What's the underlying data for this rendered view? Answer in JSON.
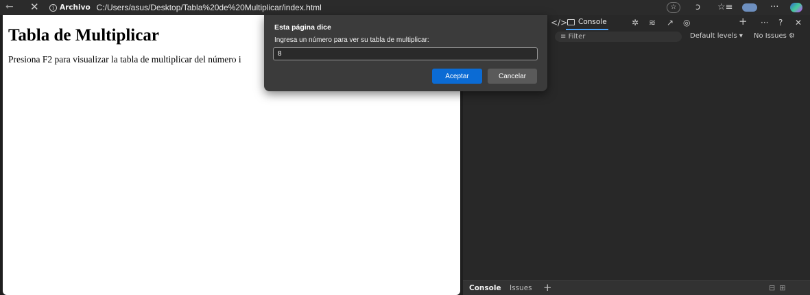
{
  "browser": {
    "address": {
      "chip_label": "Archivo",
      "url": "C:/Users/asus/Desktop/Tabla%20de%20Multiplicar/index.html"
    },
    "nav_icons": [
      "back-arrow-icon",
      "close-icon"
    ],
    "toolbar_icons": [
      "favorite-star-icon",
      "copilot-icon",
      "favorites-list-icon",
      "profile-avatar-icon",
      "more-options-icon",
      "edge-logo-icon"
    ]
  },
  "page": {
    "heading": "Tabla de Multiplicar",
    "text": "Presiona F2 para visualizar la tabla de multiplicar del número i"
  },
  "dialog": {
    "title": "Esta página dice",
    "message": "Ingresa un número para ver su tabla de multiplicar:",
    "input_value": "8",
    "ok_label": "Aceptar",
    "cancel_label": "Cancelar",
    "ok_color": "#0b6bd4"
  },
  "devtools": {
    "active_tab": "Console",
    "filter_placeholder": "Filter",
    "levels_label": "Default levels",
    "issues_label": "No Issues",
    "drawer_tabs": [
      "Console",
      "Issues"
    ],
    "accent_color": "#4ca6ff"
  }
}
